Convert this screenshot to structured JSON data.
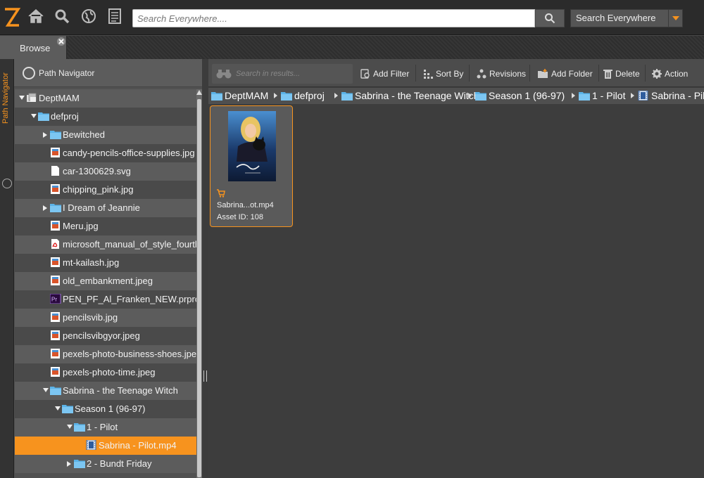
{
  "colors": {
    "accent": "#f7931e",
    "folder": "#5bb3e8"
  },
  "header": {
    "logo_icon": "z-logo-icon",
    "icons": [
      "home-icon",
      "search-icon",
      "globe-icon",
      "list-icon"
    ],
    "search": {
      "placeholder": "Search Everywhere...."
    },
    "scope": {
      "selected": "Search Everywhere"
    }
  },
  "tabs": [
    {
      "label": "Browse"
    }
  ],
  "rail": {
    "label": "Path Navigator"
  },
  "path_navigator": {
    "title": "Path Navigator",
    "tree": [
      {
        "label": "DeptMAM",
        "depth": 0,
        "icon": "archive",
        "expander": "open"
      },
      {
        "label": "defproj",
        "depth": 1,
        "icon": "folder",
        "expander": "open"
      },
      {
        "label": "Bewitched",
        "depth": 2,
        "icon": "folder",
        "expander": "closed"
      },
      {
        "label": "candy-pencils-office-supplies.jpg",
        "depth": 2,
        "icon": "image"
      },
      {
        "label": "car-1300629.svg",
        "depth": 2,
        "icon": "file"
      },
      {
        "label": "chipping_pink.jpg",
        "depth": 2,
        "icon": "image"
      },
      {
        "label": "I Dream of Jeannie",
        "depth": 2,
        "icon": "folder",
        "expander": "closed"
      },
      {
        "label": "Meru.jpg",
        "depth": 2,
        "icon": "image"
      },
      {
        "label": "microsoft_manual_of_style_fourth_e",
        "depth": 2,
        "icon": "pdf"
      },
      {
        "label": "mt-kailash.jpg",
        "depth": 2,
        "icon": "image"
      },
      {
        "label": "old_embankment.jpeg",
        "depth": 2,
        "icon": "image"
      },
      {
        "label": "PEN_PF_Al_Franken_NEW.prproj",
        "depth": 2,
        "icon": "premiere"
      },
      {
        "label": "pencilsvib.jpg",
        "depth": 2,
        "icon": "image"
      },
      {
        "label": "pencilsvibgyor.jpeg",
        "depth": 2,
        "icon": "image"
      },
      {
        "label": "pexels-photo-business-shoes.jpeg",
        "depth": 2,
        "icon": "image"
      },
      {
        "label": "pexels-photo-time.jpeg",
        "depth": 2,
        "icon": "image"
      },
      {
        "label": "Sabrina - the Teenage Witch",
        "depth": 2,
        "icon": "folder",
        "expander": "open"
      },
      {
        "label": "Season 1 (96-97)",
        "depth": 3,
        "icon": "folder",
        "expander": "open"
      },
      {
        "label": "1 - Pilot",
        "depth": 4,
        "icon": "folder",
        "expander": "open"
      },
      {
        "label": "Sabrina - Pilot.mp4",
        "depth": 5,
        "icon": "video",
        "selected": true
      },
      {
        "label": "2 - Bundt Friday",
        "depth": 4,
        "icon": "folder",
        "expander": "closed"
      }
    ]
  },
  "toolbar": {
    "search_placeholder": "Search in results...",
    "add_filter": "Add Filter",
    "sort_by": "Sort By",
    "revisions": "Revisions",
    "add_folder": "Add Folder",
    "delete": "Delete",
    "action": "Action"
  },
  "breadcrumb": [
    {
      "label": "DeptMAM",
      "icon": "folder"
    },
    {
      "label": "defproj",
      "icon": "folder"
    },
    {
      "label": "Sabrina - the Teenage Witch",
      "icon": "folder"
    },
    {
      "label": "Season 1 (96-97)",
      "icon": "folder"
    },
    {
      "label": "1 - Pilot",
      "icon": "folder"
    },
    {
      "label": "Sabrina - Pilot",
      "icon": "video"
    }
  ],
  "assets": [
    {
      "name": "Sabrina...ot.mp4",
      "asset_id_label": "Asset ID: 108",
      "thumbnail": "sabrina-poster-thumbnail"
    }
  ]
}
